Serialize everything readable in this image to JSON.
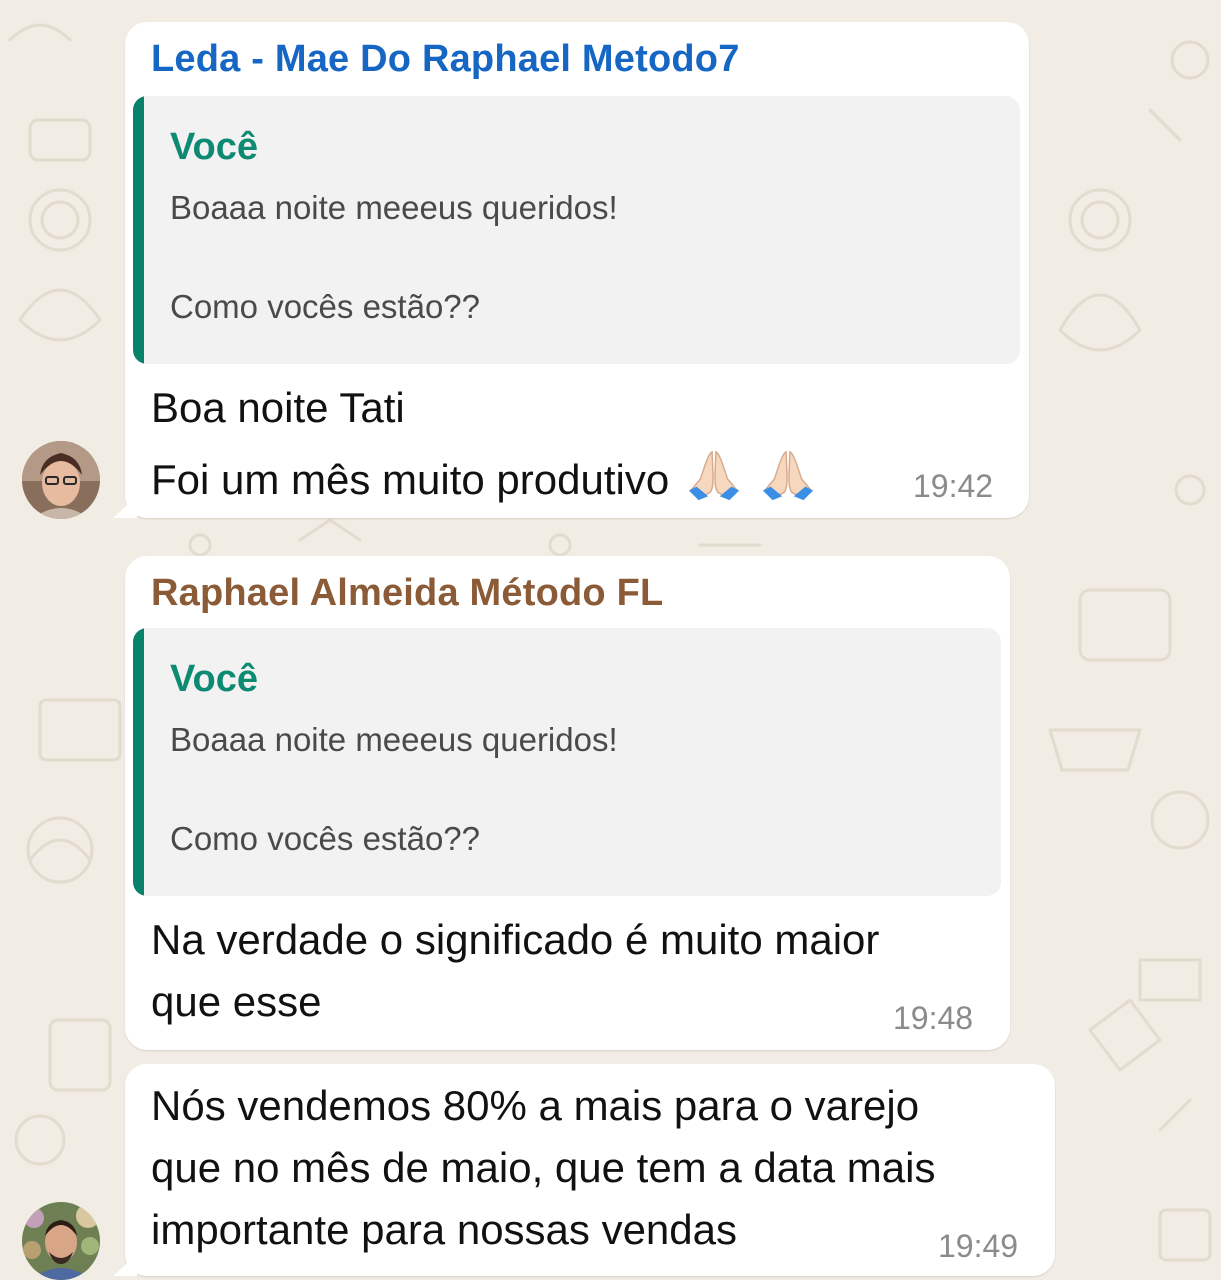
{
  "messages": [
    {
      "sender": "Leda - Mae Do Raphael Metodo7",
      "sender_color": "#1666c4",
      "quote": {
        "author": "Você",
        "line1": "Boaaa noite meeeus queridos!",
        "line2": "Como vocês estão??"
      },
      "line1": "Boa noite Tati",
      "line2": "Foi um mês muito produtivo",
      "emoji": "folded-hands-icon",
      "time": "19:42"
    },
    {
      "sender": "Raphael Almeida Método FL",
      "sender_color": "#8b5a36",
      "quote": {
        "author": "Você",
        "line1": "Boaaa noite meeeus queridos!",
        "line2": "Como vocês estão??"
      },
      "line1": "Na verdade o significado é muito maior",
      "line2": "que esse",
      "time": "19:48"
    },
    {
      "line1": "Nós vendemos 80% a mais para o varejo",
      "line2": "que no mês de maio, que tem a data mais",
      "line3": "importante para nossas vendas",
      "time": "19:49"
    }
  ],
  "colors": {
    "wallpaper": "#f1ece4",
    "bubble": "#ffffff",
    "quote_bar": "#08826b",
    "quote_author": "#0d8a72"
  }
}
